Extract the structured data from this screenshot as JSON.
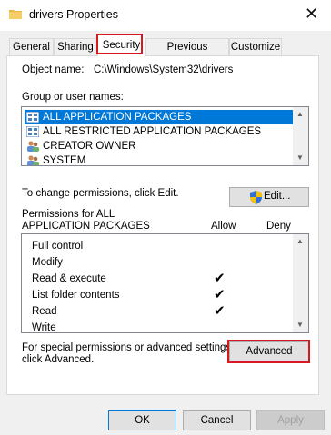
{
  "window": {
    "title": "drivers Properties",
    "close_glyph": "✕"
  },
  "tabs": [
    {
      "label": "General"
    },
    {
      "label": "Sharing"
    },
    {
      "label": "Security",
      "active": true
    },
    {
      "label": "Previous Versions"
    },
    {
      "label": "Customize"
    }
  ],
  "object": {
    "label": "Object name:",
    "value": "C:\\Windows\\System32\\drivers"
  },
  "groups": {
    "label": "Group or user names:",
    "items": [
      {
        "name": "ALL APPLICATION PACKAGES",
        "selected": true,
        "icon": "package-group-icon"
      },
      {
        "name": "ALL RESTRICTED APPLICATION PACKAGES",
        "selected": false,
        "icon": "package-group-icon"
      },
      {
        "name": "CREATOR OWNER",
        "selected": false,
        "icon": "users-icon"
      },
      {
        "name": "SYSTEM",
        "selected": false,
        "icon": "users-icon"
      }
    ]
  },
  "change_text": "To change permissions, click Edit.",
  "edit_label": "Edit...",
  "permissions": {
    "header_line1": "Permissions for ALL",
    "header_line2": "APPLICATION PACKAGES",
    "allow_label": "Allow",
    "deny_label": "Deny",
    "check_glyph": "✔",
    "rows": [
      {
        "name": "Full control",
        "allow": false,
        "deny": false
      },
      {
        "name": "Modify",
        "allow": false,
        "deny": false
      },
      {
        "name": "Read & execute",
        "allow": true,
        "deny": false
      },
      {
        "name": "List folder contents",
        "allow": true,
        "deny": false
      },
      {
        "name": "Read",
        "allow": true,
        "deny": false
      },
      {
        "name": "Write",
        "allow": false,
        "deny": false
      }
    ]
  },
  "special": {
    "line1": "For special permissions or advanced settings,",
    "line2": "click Advanced."
  },
  "advanced_label": "Advanced",
  "buttons": {
    "ok": "OK",
    "cancel": "Cancel",
    "apply": "Apply"
  },
  "colors": {
    "selection": "#0078d7",
    "highlight": "#d5191f"
  }
}
